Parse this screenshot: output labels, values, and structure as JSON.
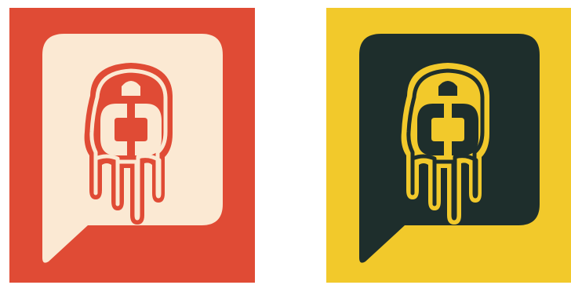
{
  "logos": [
    {
      "variant": "red",
      "background": "#E04B35",
      "bubble": "#FBE9D3",
      "mark_fill": "#E04B35",
      "mark_outline": "#E04B35",
      "mark_inner": "#FBE9D3",
      "icon": "dripping-cc-speech-bubble-icon"
    },
    {
      "variant": "yellow",
      "background": "#F2C92B",
      "bubble": "#1E2E2C",
      "mark_fill": "#F2C92B",
      "mark_outline": "#F2C92B",
      "mark_inner": "#1E2E2C",
      "icon": "dripping-cc-speech-bubble-icon"
    }
  ]
}
